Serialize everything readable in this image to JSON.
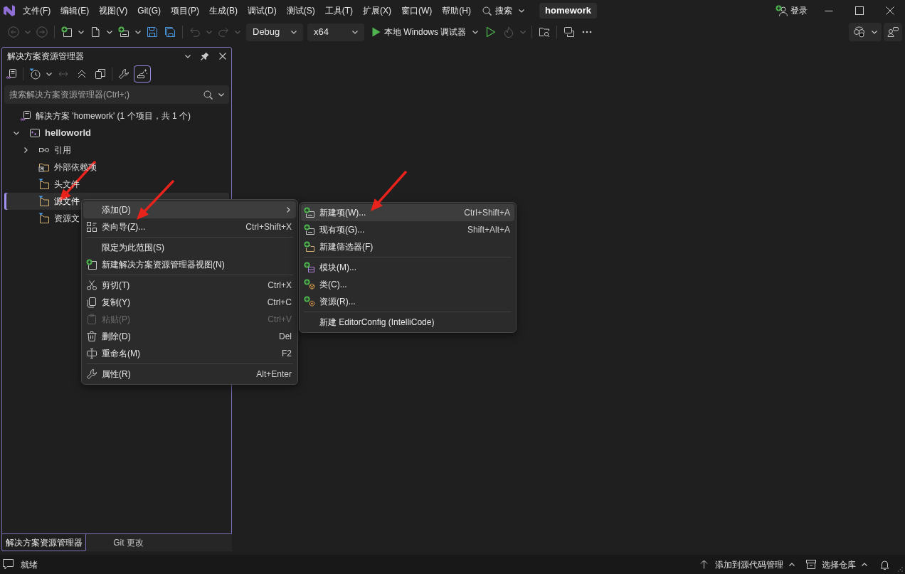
{
  "menu_bar": {
    "items": [
      "文件(F)",
      "编辑(E)",
      "视图(V)",
      "Git(G)",
      "项目(P)",
      "生成(B)",
      "调试(D)",
      "测试(S)",
      "工具(T)",
      "扩展(X)",
      "窗口(W)",
      "帮助(H)"
    ],
    "search": "搜索",
    "solution_name": "homework",
    "sign_in": "登录"
  },
  "toolbar": {
    "items": [
      {
        "kind": "back",
        "disabled": true
      },
      {
        "kind": "forward",
        "disabled": true
      },
      {
        "kind": "separator"
      },
      {
        "kind": "new-project",
        "disabled": false
      },
      {
        "kind": "new-file",
        "disabled": false
      },
      {
        "kind": "add-item",
        "disabled": false
      },
      {
        "kind": "save",
        "disabled": false
      },
      {
        "kind": "save-all",
        "disabled": false
      },
      {
        "kind": "separator"
      },
      {
        "kind": "undo",
        "disabled": true
      },
      {
        "kind": "redo",
        "disabled": true
      },
      {
        "kind": "dropdown",
        "value": "Debug"
      },
      {
        "kind": "dropdown",
        "value": "x64"
      },
      {
        "kind": "run",
        "label": "本地 Windows 调试器"
      },
      {
        "kind": "start",
        "disabled": false
      },
      {
        "kind": "hot-reload",
        "disabled": true
      },
      {
        "kind": "separator"
      },
      {
        "kind": "folder-search",
        "disabled": false
      },
      {
        "kind": "separator"
      },
      {
        "kind": "sync-view",
        "disabled": false
      },
      {
        "kind": "more",
        "disabled": false
      }
    ]
  },
  "solution_explorer": {
    "title": "解决方案资源管理器",
    "toolbar": [
      {
        "kind": "switch-views",
        "selected": false,
        "disabled": false
      },
      {
        "kind": "separator"
      },
      {
        "kind": "pending-filter",
        "selected": false,
        "disabled": false
      },
      {
        "kind": "sync",
        "selected": false,
        "disabled": true
      },
      {
        "kind": "collapse-all",
        "selected": false,
        "disabled": false
      },
      {
        "kind": "show-all-files",
        "selected": false,
        "disabled": false
      },
      {
        "kind": "separator"
      },
      {
        "kind": "properties",
        "selected": false,
        "disabled": false
      },
      {
        "kind": "preview",
        "selected": true,
        "disabled": false
      }
    ],
    "search": {
      "placeholder": "搜索解决方案资源管理器(Ctrl+;)"
    },
    "tree": [
      {
        "kind": "solution",
        "label": "解决方案 'homework' (1 个项目，共 1 个)",
        "selected": false,
        "children": [
          {
            "kind": "project",
            "label": "helloworld",
            "selected": false,
            "startup": true,
            "expanded": true,
            "children": [
              {
                "kind": "references",
                "label": "引用",
                "selected": false,
                "expanded": false
              },
              {
                "kind": "external",
                "label": "外部依赖项",
                "selected": false
              },
              {
                "kind": "filter",
                "label": "头文件",
                "selected": false
              },
              {
                "kind": "filter",
                "label": "源文件",
                "selected": true
              },
              {
                "kind": "filter",
                "label": "资源文",
                "selected": false
              }
            ]
          }
        ]
      }
    ],
    "tabs": [
      {
        "label": "解决方案资源管理器",
        "selected": true
      },
      {
        "label": "Git 更改",
        "selected": false
      }
    ]
  },
  "context_menu": {
    "groups": [
      [
        {
          "label": "添加(D)",
          "selected": true,
          "disabled": false,
          "expanded": true,
          "submenu": {
            "groups": [
              [
                {
                  "label": "新建项(W)...",
                  "shortcut": "Ctrl+Shift+A",
                  "selected": true
                },
                {
                  "label": "现有项(G)...",
                  "shortcut": "Shift+Alt+A",
                  "selected": false
                },
                {
                  "label": "新建筛选器(F)",
                  "selected": false
                }
              ],
              [
                {
                  "label": "模块(M)...",
                  "selected": false
                },
                {
                  "label": "类(C)...",
                  "selected": false
                },
                {
                  "label": "资源(R)...",
                  "selected": false
                }
              ],
              [
                {
                  "label": "新建 EditorConfig (IntelliCode)",
                  "selected": false
                }
              ]
            ]
          }
        },
        {
          "label": "类向导(Z)...",
          "shortcut": "Ctrl+Shift+X",
          "selected": false,
          "disabled": false
        }
      ],
      [
        {
          "label": "限定为此范围(S)",
          "selected": false,
          "disabled": false
        },
        {
          "label": "新建解决方案资源管理器视图(N)",
          "selected": false,
          "disabled": false
        }
      ],
      [
        {
          "label": "剪切(T)",
          "shortcut": "Ctrl+X",
          "selected": false,
          "disabled": false
        },
        {
          "label": "复制(Y)",
          "shortcut": "Ctrl+C",
          "selected": false,
          "disabled": false
        },
        {
          "label": "粘贴(P)",
          "shortcut": "Ctrl+V",
          "selected": false,
          "disabled": true
        },
        {
          "label": "删除(D)",
          "shortcut": "Del",
          "selected": false,
          "disabled": false
        },
        {
          "label": "重命名(M)",
          "shortcut": "F2",
          "selected": false,
          "disabled": false
        }
      ],
      [
        {
          "label": "属性(R)",
          "shortcut": "Alt+Enter",
          "selected": false,
          "disabled": false
        }
      ]
    ]
  },
  "status_bar": {
    "text": "就绪",
    "source_control": "添加到源代码管理",
    "repository": "选择仓库"
  },
  "annotations": [
    {
      "kind": "arrow"
    },
    {
      "kind": "arrow"
    },
    {
      "kind": "arrow"
    }
  ]
}
